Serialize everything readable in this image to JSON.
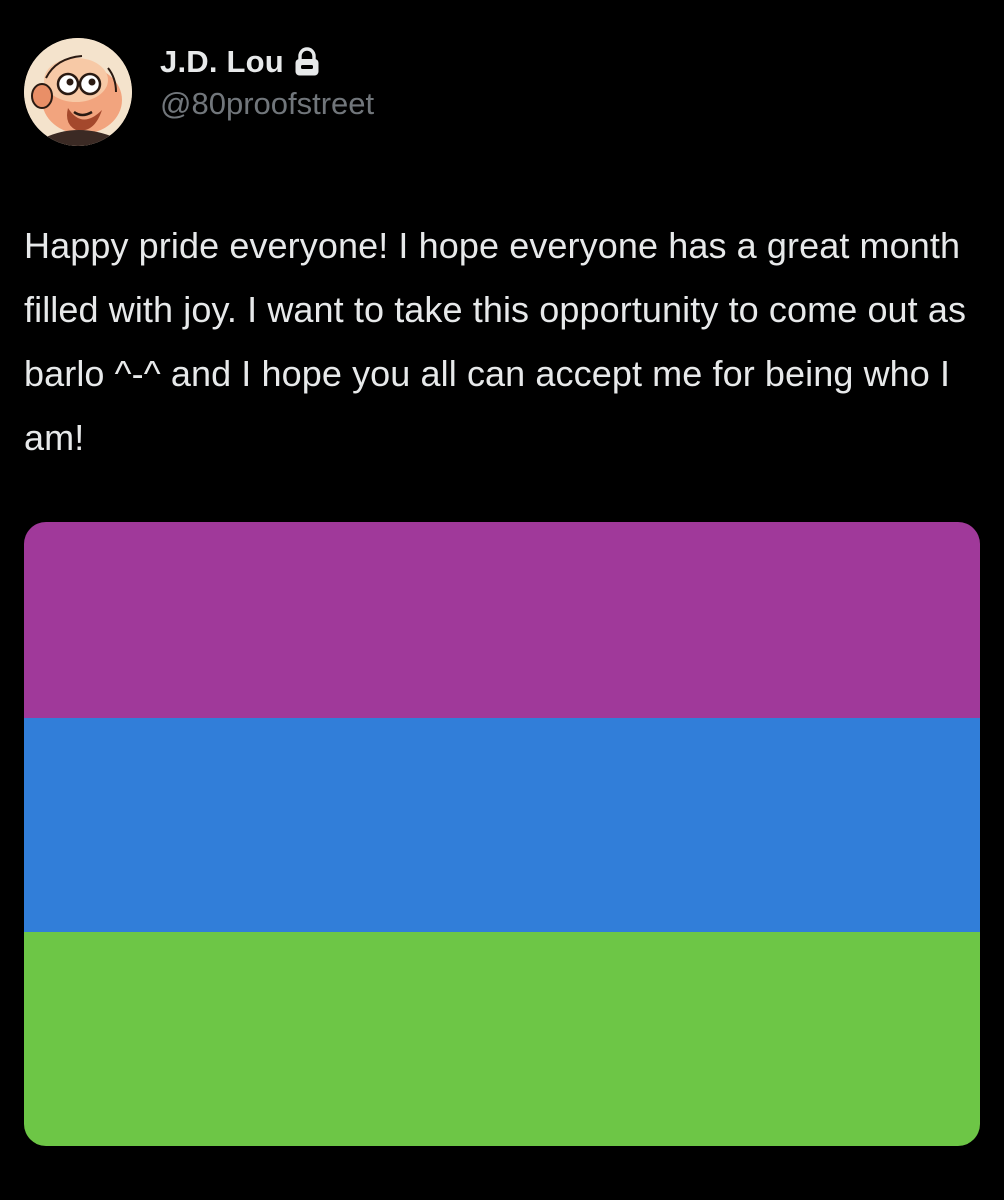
{
  "user": {
    "display_name": "J.D. Lou",
    "handle": "@80proofstreet",
    "avatar_icon": "cartoon-character-avatar",
    "protected_icon": "lock-icon"
  },
  "tweet": {
    "text": "Happy pride everyone! I hope everyone has a great month filled with joy. I want to take this opportunity to come out as barlo ^-^ and I hope you all can accept me for being who I am!"
  },
  "media": {
    "type": "flag-image",
    "stripes": [
      {
        "color": "#a0399a"
      },
      {
        "color": "#317ed9"
      },
      {
        "color": "#6dc646"
      }
    ]
  },
  "colors": {
    "background": "#000000",
    "primary_text": "#e7e9ea",
    "secondary_text": "#71767b"
  }
}
